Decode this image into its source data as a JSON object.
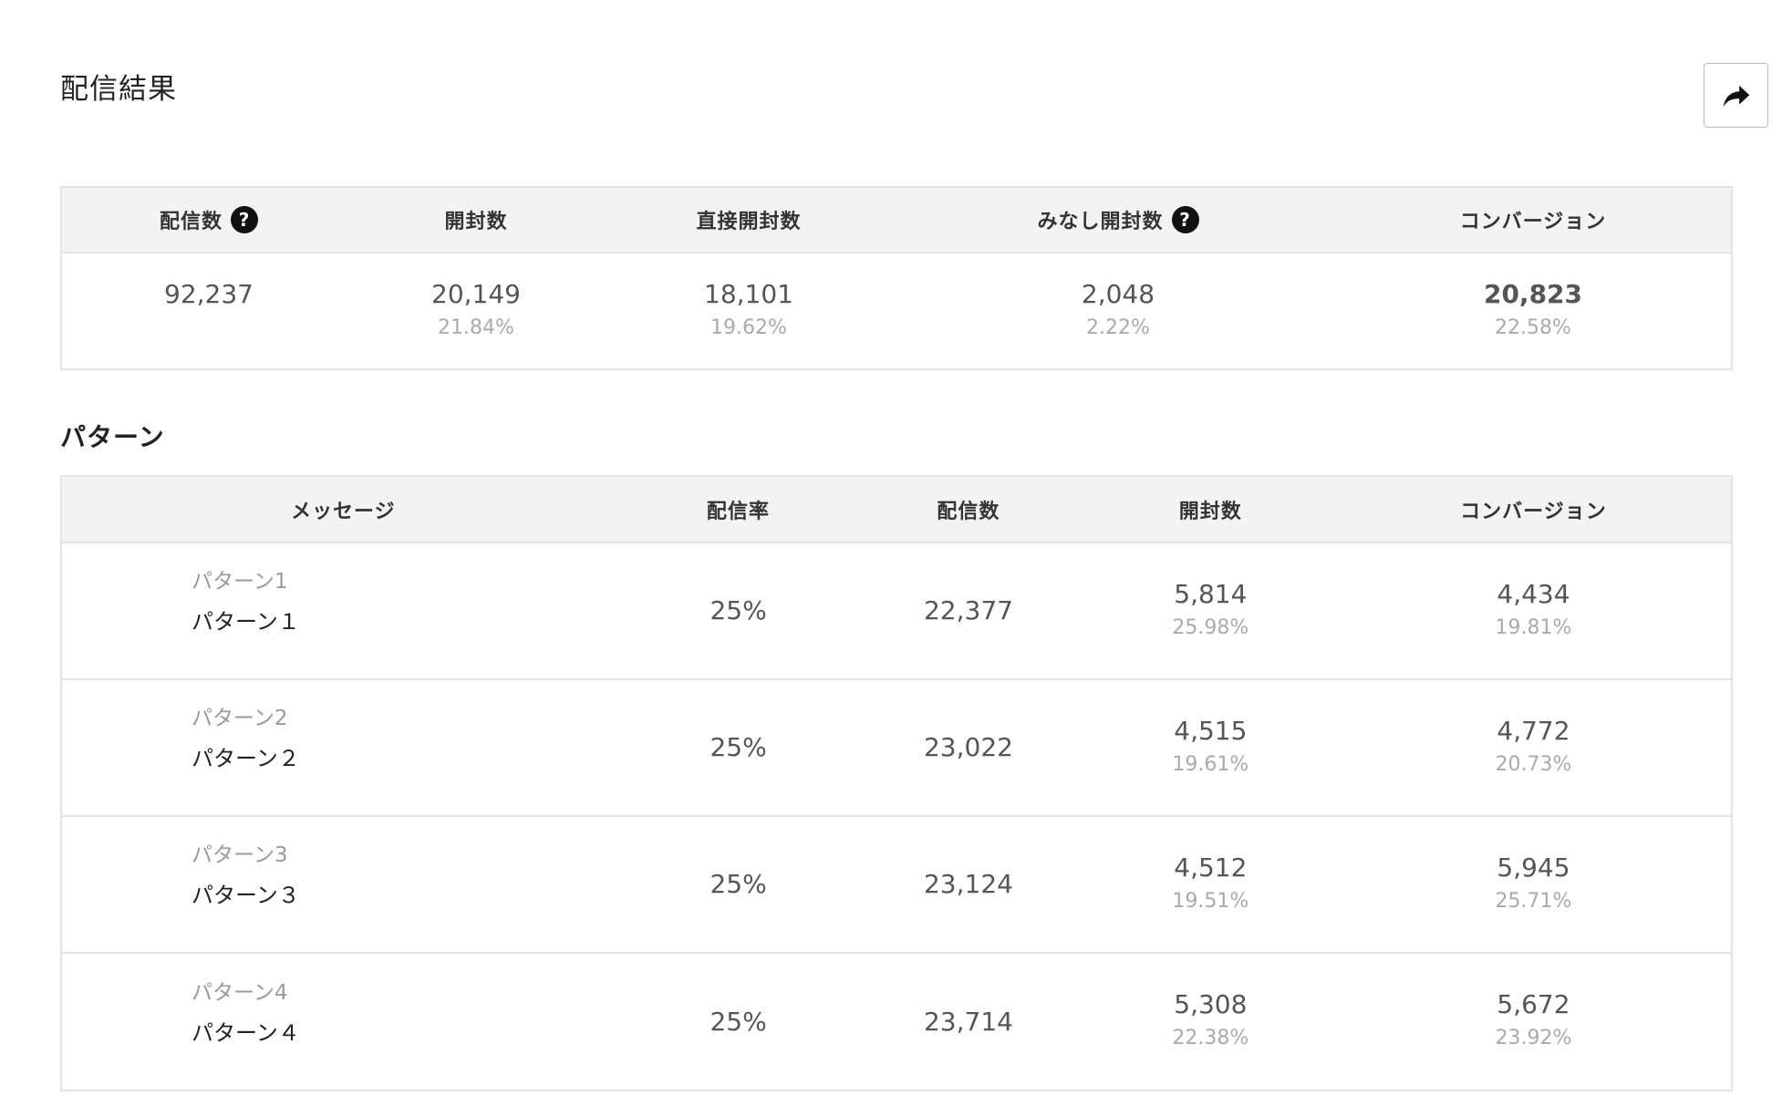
{
  "header": {
    "title": "配信結果",
    "share_icon": "share-arrow-icon"
  },
  "summary": {
    "columns": [
      {
        "label": "配信数",
        "has_help": true
      },
      {
        "label": "開封数",
        "has_help": false
      },
      {
        "label": "直接開封数",
        "has_help": false
      },
      {
        "label": "みなし開封数",
        "has_help": true
      },
      {
        "label": "コンバージョン",
        "has_help": false
      }
    ],
    "help_glyph": "?",
    "values": [
      {
        "value": "92,237",
        "rate": ""
      },
      {
        "value": "20,149",
        "rate": "21.84%"
      },
      {
        "value": "18,101",
        "rate": "19.62%"
      },
      {
        "value": "2,048",
        "rate": "2.22%"
      },
      {
        "value": "20,823",
        "rate": "22.58%"
      }
    ]
  },
  "patterns": {
    "section_title": "パターン",
    "columns": [
      "メッセージ",
      "配信率",
      "配信数",
      "開封数",
      "コンバージョン"
    ],
    "rows": [
      {
        "name": "パターン1",
        "message": "パターン１",
        "rate": "25%",
        "delivered": "22,377",
        "opened": "5,814",
        "opened_rate": "25.98%",
        "conversion": "4,434",
        "conversion_rate": "19.81%"
      },
      {
        "name": "パターン2",
        "message": "パターン２",
        "rate": "25%",
        "delivered": "23,022",
        "opened": "4,515",
        "opened_rate": "19.61%",
        "conversion": "4,772",
        "conversion_rate": "20.73%"
      },
      {
        "name": "パターン3",
        "message": "パターン３",
        "rate": "25%",
        "delivered": "23,124",
        "opened": "4,512",
        "opened_rate": "19.51%",
        "conversion": "5,945",
        "conversion_rate": "25.71%"
      },
      {
        "name": "パターン4",
        "message": "パターン４",
        "rate": "25%",
        "delivered": "23,714",
        "opened": "5,308",
        "opened_rate": "22.38%",
        "conversion": "5,672",
        "conversion_rate": "23.92%"
      }
    ]
  },
  "colors": {
    "header_bg": "#f3f3f3",
    "border": "#e3e3e3",
    "muted_text": "#aaaaaa",
    "value_text": "#555555"
  }
}
